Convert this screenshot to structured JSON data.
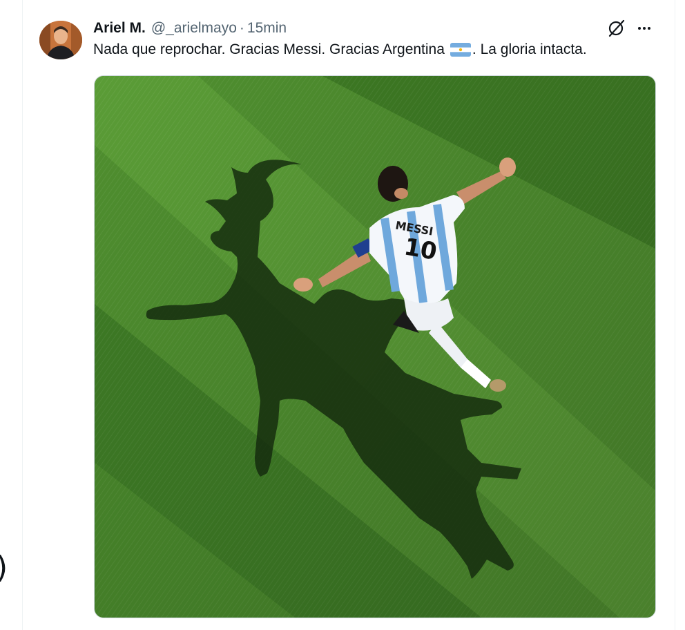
{
  "tweet": {
    "author_name": "Ariel M.",
    "handle": "@_arielmayo",
    "separator": "·",
    "time": "15min",
    "text_before_flag": "Nada que reprochar. Gracias Messi. Gracias Argentina",
    "text_after_flag": ". La gloria intacta."
  },
  "media": {
    "jersey_name": "MESSI",
    "jersey_number": "10"
  },
  "icons": {
    "avatar": "avatar",
    "grok": "grok-icon",
    "more": "more-icon",
    "flag": "argentina-flag-icon"
  },
  "colors": {
    "text_primary": "#0f1419",
    "text_secondary": "#536471",
    "grass": "#4f8f2f",
    "flag_blue": "#74acdf"
  }
}
